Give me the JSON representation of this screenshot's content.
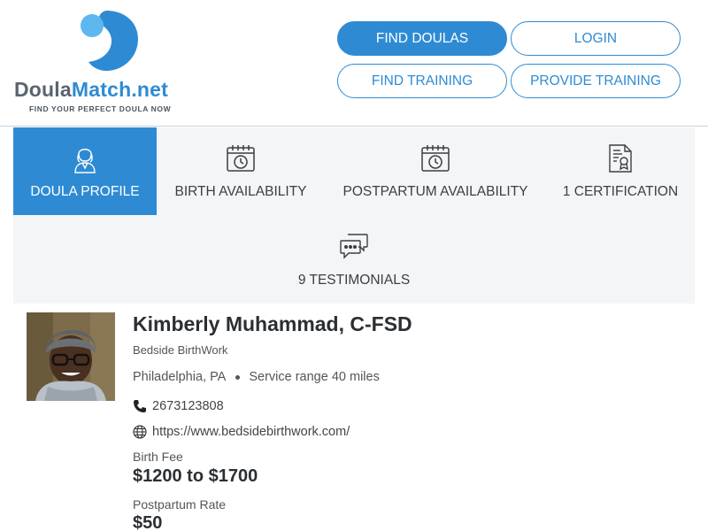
{
  "header": {
    "logo": {
      "brand_part1": "Doula",
      "brand_part2": "Match.net",
      "tagline": "FIND YOUR PERFECT DOULA NOW"
    },
    "nav": {
      "find_doulas": "FIND DOULAS",
      "login": "LOGIN",
      "find_training": "FIND TRAINING",
      "provide_training": "PROVIDE TRAINING"
    },
    "colors": {
      "accent": "#2e8bd3",
      "accent_light": "#5fb7ef"
    }
  },
  "tabs": [
    {
      "label": "DOULA PROFILE",
      "icon": "doula-person-icon",
      "active": true
    },
    {
      "label": "BIRTH AVAILABILITY",
      "icon": "calendar-clock-icon",
      "active": false
    },
    {
      "label": "POSTPARTUM AVAILABILITY",
      "icon": "calendar-clock-icon",
      "active": false
    },
    {
      "label": "1 CERTIFICATION",
      "icon": "certificate-icon",
      "active": false
    },
    {
      "label": "9 TESTIMONIALS",
      "icon": "chat-bubbles-icon",
      "active": false
    }
  ],
  "profile": {
    "name": "Kimberly Muhammad, C-FSD",
    "business": "Bedside BirthWork",
    "location": "Philadelphia, PA",
    "service_range": "Service range 40 miles",
    "phone": "2673123808",
    "website": "https://www.bedsidebirthwork.com/",
    "birth_fee_label": "Birth Fee",
    "birth_fee_value": "$1200 to $1700",
    "postpartum_rate_label": "Postpartum Rate",
    "postpartum_rate_value": "$50"
  }
}
